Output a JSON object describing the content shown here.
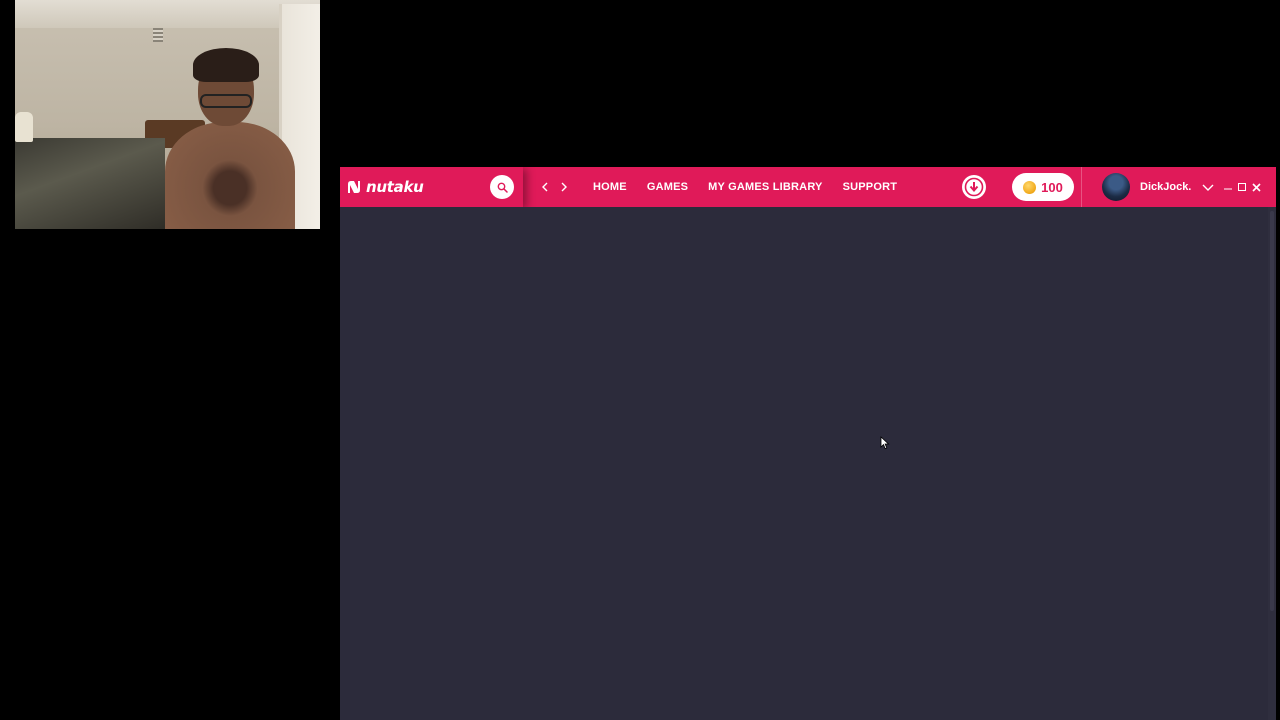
{
  "app": {
    "brand": "nutaku",
    "brand_color": "#e01a59",
    "background_color": "#2c2b3b"
  },
  "topbar": {
    "search_icon": "search-icon",
    "back_icon": "chevron-left-icon",
    "forward_icon": "chevron-right-icon",
    "menu": [
      {
        "label": "HOME"
      },
      {
        "label": "GAMES"
      },
      {
        "label": "MY GAMES LIBRARY"
      },
      {
        "label": "SUPPORT"
      }
    ],
    "download_icon": "download-icon",
    "coins": {
      "value": "100",
      "icon": "coin-icon"
    },
    "user": {
      "name": "DickJock..."
    },
    "window_controls": [
      "minimize-icon",
      "maximize-icon",
      "close-icon"
    ]
  }
}
